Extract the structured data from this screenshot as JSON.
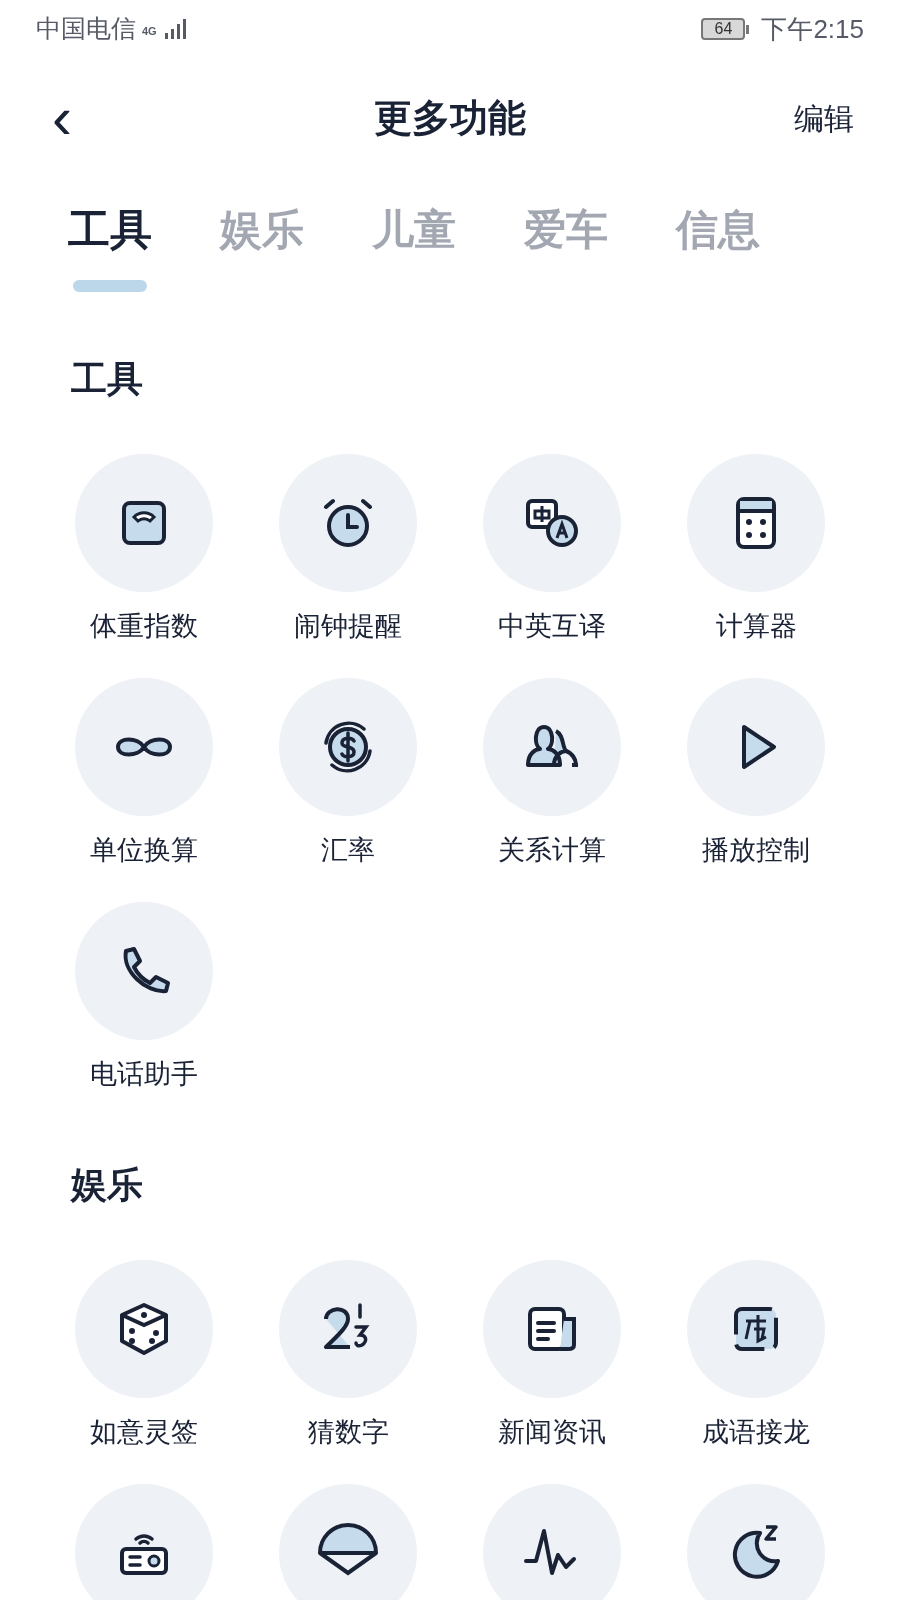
{
  "status_bar": {
    "carrier": "中国电信",
    "network": "4G",
    "battery": "64",
    "time": "下午2:15"
  },
  "header": {
    "back": "‹",
    "title": "更多功能",
    "action": "编辑"
  },
  "tabs": [
    {
      "label": "工具",
      "selected": true
    },
    {
      "label": "娱乐",
      "selected": false
    },
    {
      "label": "儿童",
      "selected": false
    },
    {
      "label": "爱车",
      "selected": false
    },
    {
      "label": "信息",
      "selected": false
    }
  ],
  "sections": [
    {
      "title": "工具",
      "items": [
        {
          "kind": "labeled",
          "label": "体重指数"
        },
        {
          "kind": "labeled",
          "label": "闹钟提醒"
        },
        {
          "kind": "labeled",
          "label": "中英互译"
        },
        {
          "kind": "labeled",
          "label": "计算器"
        },
        {
          "kind": "labeled",
          "label": "单位换算"
        },
        {
          "kind": "labeled",
          "label": "汇率"
        },
        {
          "kind": "labeled",
          "label": "关系计算"
        },
        {
          "kind": "labeled",
          "label": "播放控制"
        },
        {
          "kind": "labeled",
          "label": "电话助手"
        }
      ]
    },
    {
      "title": "娱乐",
      "items": [
        {
          "kind": "labeled",
          "label": "如意灵签"
        },
        {
          "kind": "labeled",
          "label": "猜数字"
        },
        {
          "kind": "labeled",
          "label": "新闻资讯"
        },
        {
          "kind": "labeled",
          "label": "成语接龙"
        },
        {
          "kind": "cut_off"
        },
        {
          "kind": "cut_off"
        },
        {
          "kind": "cut_off"
        },
        {
          "kind": "cut_off"
        }
      ]
    }
  ]
}
